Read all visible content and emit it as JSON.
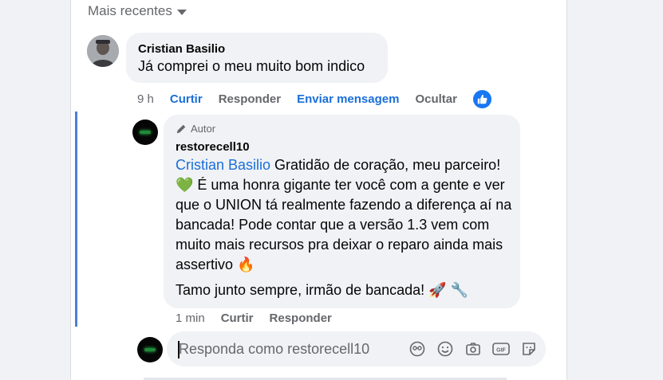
{
  "sort": {
    "label": "Mais recentes"
  },
  "comment": {
    "author": "Cristian Basilio",
    "text": "Já comprei o meu muito bom indico",
    "actions": {
      "time": "9 h",
      "like": "Curtir",
      "reply": "Responder",
      "message": "Enviar mensagem",
      "hide": "Ocultar"
    }
  },
  "reply": {
    "badge": "Autor",
    "author": "restorecell10",
    "mention": "Cristian Basilio",
    "text": " Gratidão de coração, meu parceiro! 💚 É uma honra gigante ter você com a gente e ver que o UNION tá realmente fazendo a diferença aí na bancada! Pode contar que a versão 1.3 vem com muito mais recursos pra deixar o reparo ainda mais assertivo 🔥",
    "text2": "Tamo junto sempre, irmão de bancada! 🚀 🔧",
    "actions": {
      "time": "1 min",
      "like": "Curtir",
      "reply": "Responder"
    }
  },
  "composer": {
    "placeholder": "Responda como restorecell10"
  },
  "colors": {
    "link": "#1a6fd9",
    "like_blue": "#1877f2",
    "bubble": "#f0f2f5",
    "secondary_text": "#65676b"
  },
  "icons": [
    "chevron-down-icon",
    "pencil-icon",
    "thumbs-up-icon",
    "avatar-icon",
    "emoji-icon",
    "camera-icon",
    "gif-icon",
    "sticker-icon"
  ]
}
